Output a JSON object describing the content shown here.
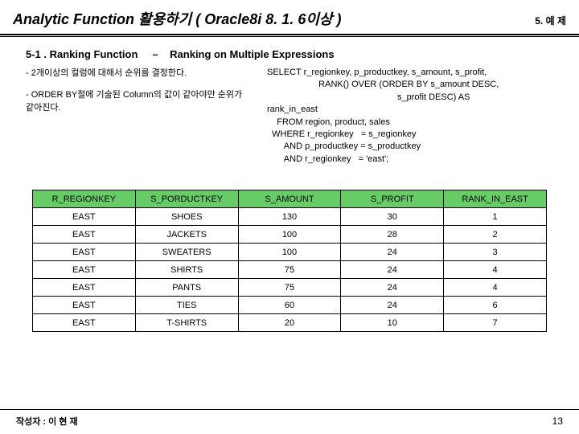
{
  "header": {
    "title": "Analytic Function 활용하기 ( Oracle8i 8. 1. 6이상 )",
    "section": "5. 예 제"
  },
  "subheading": {
    "left": "5-1 . Ranking Function",
    "sep": "–",
    "right": "Ranking on Multiple Expressions"
  },
  "bullets": {
    "b1": "- 2개이상의 컬럼에 대해서 순위를 결정한다.",
    "b2": "- ORDER BY절에 기술된 Column의 값이 같아야만 순위가 같아진다."
  },
  "sql": "SELECT r_regionkey, p_productkey, s_amount, s_profit,\n                     RANK() OVER (ORDER BY s_amount DESC,\n                                                     s_profit DESC) AS\nrank_in_east\n    FROM region, product, sales\n  WHERE r_regionkey   = s_regionkey\n       AND p_productkey = s_productkey\n       AND r_regionkey   = 'east';",
  "table": {
    "headers": [
      "R_REGIONKEY",
      "S_PORDUCTKEY",
      "S_AMOUNT",
      "S_PROFIT",
      "RANK_IN_EAST"
    ],
    "rows": [
      [
        "EAST",
        "SHOES",
        "130",
        "30",
        "1"
      ],
      [
        "EAST",
        "JACKETS",
        "100",
        "28",
        "2"
      ],
      [
        "EAST",
        "SWEATERS",
        "100",
        "24",
        "3"
      ],
      [
        "EAST",
        "SHIRTS",
        "75",
        "24",
        "4"
      ],
      [
        "EAST",
        "PANTS",
        "75",
        "24",
        "4"
      ],
      [
        "EAST",
        "TIES",
        "60",
        "24",
        "6"
      ],
      [
        "EAST",
        "T-SHIRTS",
        "20",
        "10",
        "7"
      ]
    ]
  },
  "footer": {
    "author": "작성자 : 이 현 재",
    "page": "13"
  }
}
